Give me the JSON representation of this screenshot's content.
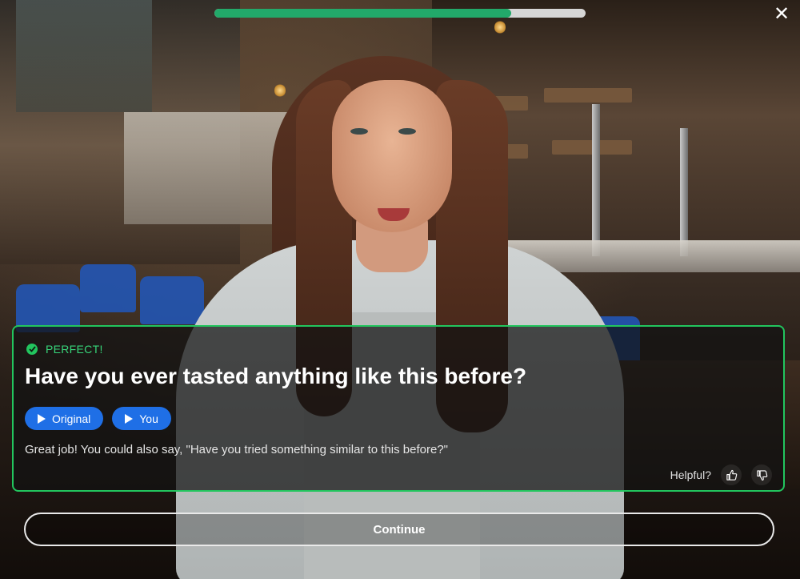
{
  "progress": {
    "fraction": 0.8
  },
  "close": {
    "glyph": "✕"
  },
  "feedback": {
    "status": "PERFECT!",
    "prompt": "Have you ever tasted anything like this before?",
    "play_original_label": "Original",
    "play_you_label": "You",
    "suggestion": "Great job! You could also say, \"Have you tried something similar to this before?\"",
    "helpful_label": "Helpful?"
  },
  "continue_label": "Continue",
  "colors": {
    "accent_green": "#22c55e",
    "play_blue": "#1f6fe6",
    "progress_green": "#22a96a"
  },
  "icons": [
    "close-icon",
    "check-circle-icon",
    "play-icon",
    "thumbs-up-icon",
    "thumbs-down-icon"
  ]
}
